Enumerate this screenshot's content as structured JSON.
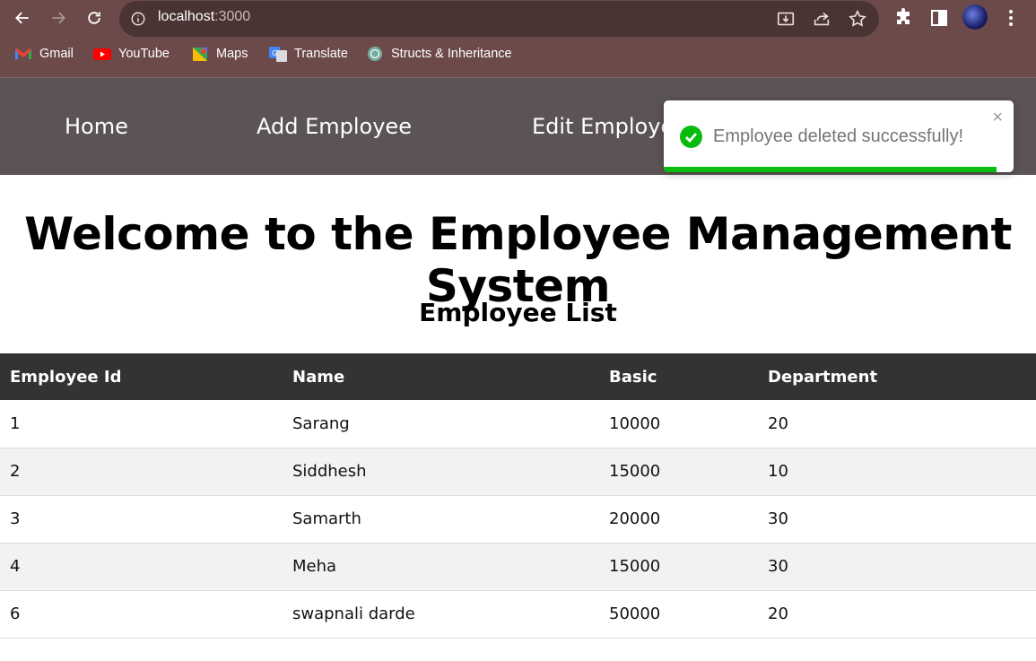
{
  "browser": {
    "url_host": "localhost",
    "url_port": ":3000",
    "bookmarks": [
      {
        "label": "Gmail",
        "icon": "gmail-icon"
      },
      {
        "label": "YouTube",
        "icon": "youtube-icon"
      },
      {
        "label": "Maps",
        "icon": "maps-icon"
      },
      {
        "label": "Translate",
        "icon": "translate-icon"
      },
      {
        "label": "Structs & Inheritance",
        "icon": "chatgpt-icon"
      }
    ]
  },
  "nav": {
    "items": [
      "Home",
      "Add Employee",
      "Edit Employee"
    ]
  },
  "toast": {
    "message": "Employee deleted successfully!",
    "close": "×",
    "progress": 0.95,
    "color": "#07bc0c"
  },
  "page": {
    "title": "Welcome to the Employee Management System",
    "subtitle": "Employee List"
  },
  "table": {
    "headers": [
      "Employee Id",
      "Name",
      "Basic",
      "Department"
    ],
    "rows": [
      [
        "1",
        "Sarang",
        "10000",
        "20"
      ],
      [
        "2",
        "Siddhesh",
        "15000",
        "10"
      ],
      [
        "3",
        "Samarth",
        "20000",
        "30"
      ],
      [
        "4",
        "Meha",
        "15000",
        "30"
      ],
      [
        "6",
        "swapnali darde",
        "50000",
        "20"
      ]
    ]
  }
}
